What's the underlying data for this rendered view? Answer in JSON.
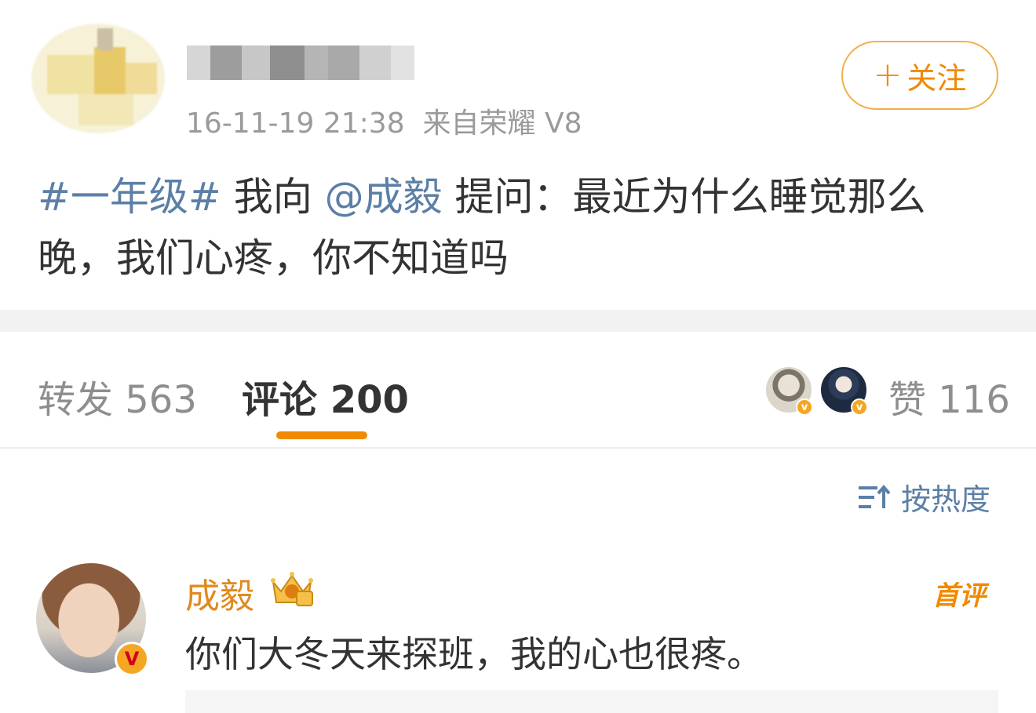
{
  "post": {
    "meta_time": "16-11-19 21:38",
    "meta_from": "来自",
    "meta_device": "荣耀 V8",
    "follow_label": "关注",
    "topic": "#一年级#",
    "text_mid": " 我向 ",
    "mention": "@成毅",
    "text_tail": " 提问：最近为什么睡觉那么晚，我们心疼，你不知道吗"
  },
  "tabs": {
    "repost": "转发 563",
    "comment": "评论 200",
    "like": "赞 116"
  },
  "sort": {
    "label": "按热度"
  },
  "comment": {
    "author": "成毅",
    "first_tag": "首评",
    "text": "你们大冬天来探班，我的心也很疼。",
    "avatar_badge": "V"
  },
  "colors": {
    "accent": "#f08a00",
    "link": "#5b7fa6",
    "muted": "#8e8e8e",
    "author": "#e08a1e"
  },
  "icons": {
    "follow": "plus-icon",
    "sort": "sort-lines-icon",
    "crown": "crown-badge-icon",
    "verified": "verified-v-icon"
  }
}
